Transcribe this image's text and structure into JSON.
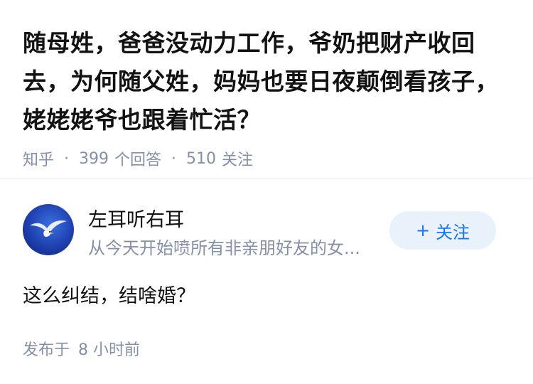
{
  "question": {
    "title": "随母姓，爸爸没动力工作，爷奶把财产收回去，为何随父姓，妈妈也要日夜颠倒看孩子，姥姥姥爷也跟着忙活？",
    "source": "知乎",
    "answer_count": "399",
    "answer_label": "个回答",
    "follower_count": "510",
    "follower_label": "关注",
    "separator": "·"
  },
  "answer": {
    "author": {
      "name": "左耳听右耳",
      "bio": "从今天开始喷所有非亲朋好友的女...",
      "avatar_icon": "seagull-avatar"
    },
    "follow_button": {
      "plus": "+",
      "label": "关注"
    },
    "content": "这么纠结，结啥婚？",
    "published_prefix": "发布于",
    "published_time": "8 小时前"
  },
  "colors": {
    "text": "#121212",
    "meta": "#8590a6",
    "brand": "#1772f6",
    "button_bg": "#e9f1fb",
    "avatar_blue": "#1e3fae"
  }
}
